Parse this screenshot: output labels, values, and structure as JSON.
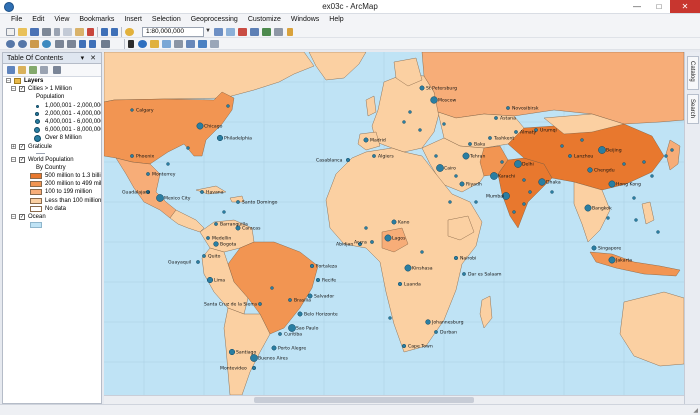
{
  "window": {
    "title": "ex03c - ArcMap",
    "min_glyph": "—",
    "max_glyph": "□",
    "close_glyph": "✕"
  },
  "menu": [
    "File",
    "Edit",
    "View",
    "Bookmarks",
    "Insert",
    "Selection",
    "Geoprocessing",
    "Customize",
    "Windows",
    "Help"
  ],
  "toolbar": {
    "scale": "1:80,000,000",
    "dropdown_glyph": "▼",
    "icons": [
      "new-document-icon",
      "open-icon",
      "save-icon",
      "print-icon",
      "cut-icon",
      "copy-icon",
      "paste-icon",
      "delete-icon",
      "undo-icon",
      "redo-icon",
      "add-data-icon",
      "editor-icon",
      "catalog-icon",
      "arctoolbox-icon",
      "search-window-icon",
      "python-icon",
      "zoom-in-icon",
      "zoom-out-icon",
      "pan-icon",
      "full-extent-icon",
      "fixed-zoom-in-icon",
      "fixed-zoom-out-icon",
      "back-icon",
      "forward-icon",
      "select-features-icon",
      "clear-selection-icon",
      "select-elements-icon",
      "identify-icon",
      "hyperlink-icon",
      "html-popup-icon",
      "measure-icon",
      "find-icon",
      "go-to-xy-icon",
      "time-slider-icon"
    ]
  },
  "toc": {
    "title": "Table Of Contents",
    "header_buttons": "▾ ✕",
    "root": "Layers",
    "layers": [
      {
        "name": "Cities > 1 Million",
        "checked": true,
        "field": "Population",
        "classes": [
          {
            "label": "1,000,001 - 2,000,000",
            "size": 2
          },
          {
            "label": "2,000,001 - 4,000,000",
            "size": 3
          },
          {
            "label": "4,000,001 - 6,000,000",
            "size": 4
          },
          {
            "label": "6,000,001 - 8,000,000",
            "size": 5
          },
          {
            "label": "Over 8 Million",
            "size": 6
          }
        ]
      },
      {
        "name": "Graticule",
        "checked": true
      },
      {
        "name": "World Population",
        "checked": true,
        "field": "By Country",
        "classes": [
          {
            "label": "500 million to 1.3 billion",
            "color": "#e8782e"
          },
          {
            "label": "200 million to 499 million",
            "color": "#f29552"
          },
          {
            "label": "100 to 199 million",
            "color": "#f7ad78"
          },
          {
            "label": "Less than 100 million",
            "color": "#fbd0a2"
          },
          {
            "label": "No data",
            "color": "#ffffff"
          }
        ]
      },
      {
        "name": "Ocean",
        "checked": true,
        "color": "#bfe3f5"
      }
    ]
  },
  "dock": {
    "tabs": [
      "Catalog",
      "Search"
    ]
  },
  "map": {
    "ocean_color": "#bfe3f5",
    "colors": {
      "c1": "#e8782e",
      "c2": "#f29552",
      "c3": "#f7ad78",
      "c4": "#fbd0a2"
    },
    "labels": [
      "St Petersburg",
      "Moscow",
      "Novosibirsk",
      "Calgary",
      "Chicago",
      "Philadelphia",
      "Phoenix",
      "Monterrey",
      "Mexico City",
      "Guadalajara",
      "Havana",
      "Santo Domingo",
      "Barranquilla",
      "Caracas",
      "Medellin",
      "Bogota",
      "Quito",
      "Guayaquil",
      "Lima",
      "Fortaleza",
      "Recife",
      "Salvador",
      "Brasilia",
      "Belo Horizonte",
      "Santa Cruz de la Sierra",
      "Sao Paulo",
      "Curitiba",
      "Porto Alegre",
      "Santiago",
      "Buenos Aires",
      "Montevideo",
      "Madrid",
      "Casablanca",
      "Algiers",
      "Cairo",
      "Kano",
      "Lagos",
      "Accra",
      "Abidjan",
      "Kinshasa",
      "Luanda",
      "Nairobi",
      "Dar es Salaam",
      "Johannesburg",
      "Cape Town",
      "Durban",
      "Riyadh",
      "Tehran",
      "Karachi",
      "Delhi",
      "Mumbai",
      "Dhaka",
      "Beijing",
      "Lanzhou",
      "Chengdu",
      "Hong Kong",
      "Bangkok",
      "Singapore",
      "Jakarta",
      "Urumqi",
      "Astana",
      "Baku",
      "Tashkent",
      "Almaty"
    ]
  }
}
